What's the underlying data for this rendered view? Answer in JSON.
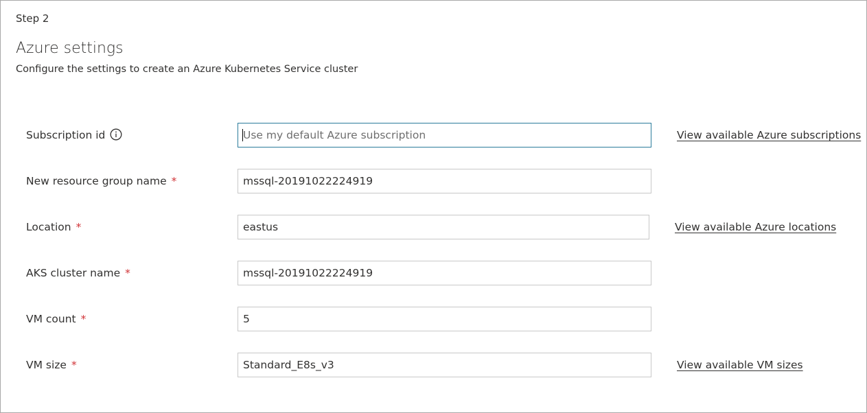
{
  "header": {
    "step": "Step 2",
    "title": "Azure settings",
    "subtitle": "Configure the settings to create an Azure Kubernetes Service cluster"
  },
  "fields": {
    "subscription": {
      "label": "Subscription id",
      "required": false,
      "icon": "info-icon",
      "value": "",
      "placeholder": "Use my default Azure subscription",
      "link": "View available Azure subscriptions"
    },
    "resource_group": {
      "label": "New resource group name",
      "required_marker": "*",
      "value": "mssql-20191022224919"
    },
    "location": {
      "label": "Location",
      "required_marker": "*",
      "value": "eastus",
      "link": "View available Azure locations"
    },
    "aks_cluster": {
      "label": "AKS cluster name",
      "required_marker": "*",
      "value": "mssql-20191022224919"
    },
    "vm_count": {
      "label": "VM count",
      "required_marker": "*",
      "value": "5"
    },
    "vm_size": {
      "label": "VM size",
      "required_marker": "*",
      "value": "Standard_E8s_v3",
      "link": "View available VM sizes"
    }
  },
  "colors": {
    "required": "#d13438",
    "focus_border": "#2a7b9b",
    "border": "#c8c8c8",
    "text": "#323130"
  }
}
